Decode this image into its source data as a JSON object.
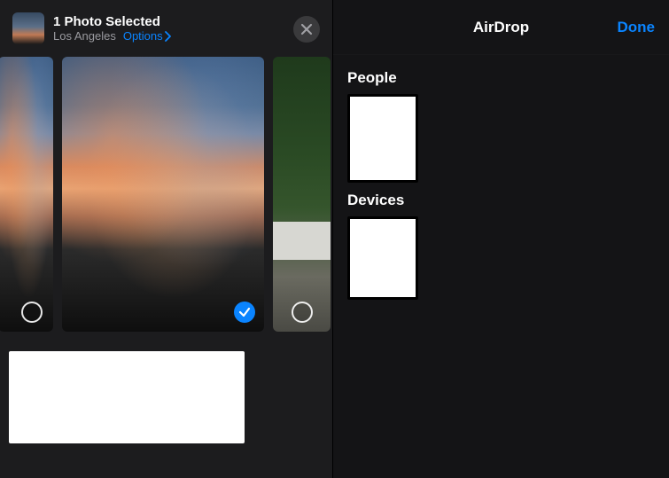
{
  "share": {
    "title": "1 Photo Selected",
    "location": "Los Angeles",
    "options_label": "Options",
    "close_aria": "Close"
  },
  "photos": {
    "item0_selected": false,
    "item1_selected": true,
    "item2_selected": false
  },
  "airdrop": {
    "title": "AirDrop",
    "done_label": "Done",
    "people_label": "People",
    "devices_label": "Devices"
  },
  "colors": {
    "accent": "#0a84ff"
  }
}
